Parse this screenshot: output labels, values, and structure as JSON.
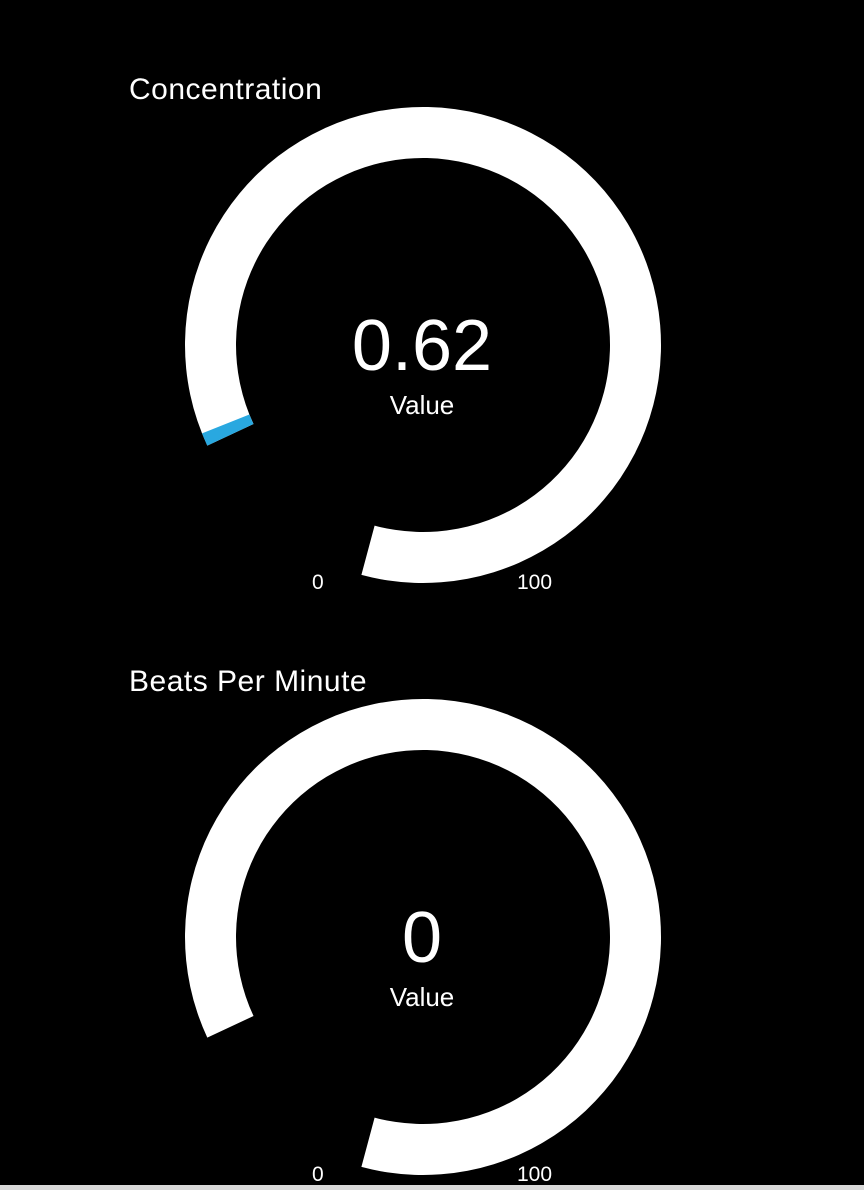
{
  "colors": {
    "background": "#000000",
    "track": "#ffffff",
    "fill": "#29a8e0",
    "text": "#ffffff"
  },
  "gauges": [
    {
      "title": "Concentration",
      "value": 0.62,
      "value_text": "0.62",
      "value_label": "Value",
      "min": 0,
      "max": 100,
      "min_label": "0",
      "max_label": "100"
    },
    {
      "title": "Beats Per Minute",
      "value": 0,
      "value_text": "0",
      "value_label": "Value",
      "min": 0,
      "max": 100,
      "min_label": "0",
      "max_label": "100"
    }
  ]
}
